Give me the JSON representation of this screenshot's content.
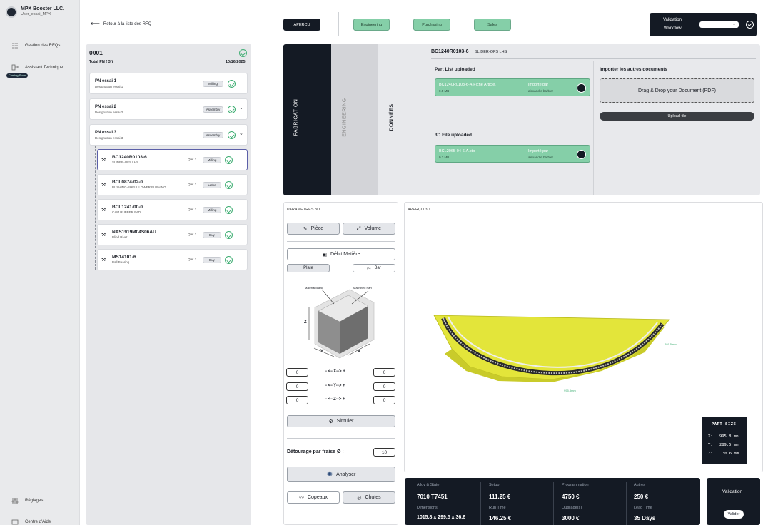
{
  "company": {
    "name": "MPX Booster LLC",
    "user": "User_essai_MPX"
  },
  "sidebar": {
    "items": [
      {
        "label": "Gestion des RFQs"
      },
      {
        "label": "Assistant Technique"
      },
      {
        "label": "Réglages"
      },
      {
        "label": "Centre d'Aide"
      }
    ],
    "beta_tag": "Coming Soon"
  },
  "topbar": {
    "back_label": "Retour à la liste des RFQ",
    "tabs": [
      {
        "label": "APERÇU",
        "style": "dark"
      },
      {
        "label": "Engineering",
        "style": "green"
      },
      {
        "label": "Purchasing",
        "style": "green"
      },
      {
        "label": "Sales",
        "style": "green"
      }
    ],
    "validation": {
      "line1": "Validation",
      "line2": "Workflow"
    }
  },
  "rfq": {
    "id": "0001",
    "total_pn": "Total PN ( 3 )",
    "date": "10/16/2025",
    "pns": [
      {
        "title": "PN essai 1",
        "designation": "Designation essai 1",
        "badge": "Milling",
        "has_chevron": false
      },
      {
        "title": "PN essai 2",
        "designation": "Designation essai 2",
        "badge": "Assembly",
        "has_chevron": true
      },
      {
        "title": "PN essai 3",
        "designation": "Designation essai 3",
        "badge": "Assembly",
        "has_chevron": true
      }
    ],
    "parts": [
      {
        "code": "BC1240R0103-6",
        "desc": "SLIDER-OFS LHS",
        "qty": "Qté: 1",
        "badge": "Milling",
        "selected": true
      },
      {
        "code": "BCL0874-02-0",
        "desc": "BUSHING-SHELL LOWER BUSHING",
        "qty": "Qté: 2",
        "badge": "Lathe",
        "selected": false
      },
      {
        "code": "BCL1241-00-0",
        "desc": "CAM RUBBER PAD",
        "qty": "Qté: 1",
        "badge": "Milling",
        "selected": false
      },
      {
        "code": "NAS1919M04S06AU",
        "desc": "Blind Rivet",
        "qty": "Qté: 2",
        "badge": "Buy",
        "selected": false
      },
      {
        "code": "MS14101-6",
        "desc": "Ball Bearing",
        "qty": "Qté: 1",
        "badge": "Buy",
        "selected": false
      }
    ]
  },
  "donnees": {
    "tab_fabrication": "FABRICATION",
    "tab_engineering": "ENGINEERING",
    "tab_donnees": "DONNÉES",
    "part_code": "BC1240R0103-6",
    "part_desc": "SLIDER-OFS LHS",
    "part_list_title": "Part List uploaded",
    "part_list_file": "BC1240R0103-6-A-Fiche Article.",
    "part_list_size": "0.5 MB",
    "imported_by": "Importé par",
    "importer": "alexandre barbier",
    "file3d_title": "3D File uploaded",
    "file3d_name": "BCL2065-04-6-A.stp",
    "file3d_size": "0.3 MB",
    "other_docs_title": "Importer les autres documents",
    "dropzone_label": "Drag & Drop your Document (PDF)",
    "upload_label": "Upload file"
  },
  "params": {
    "title": "PARAMETRES 3D",
    "btn_piece": "Pièce",
    "btn_volume": "Volume",
    "btn_debit": "Débit Matière",
    "btn_plate": "Plate",
    "btn_bar": "Bar",
    "diagram_material": "Material Blank",
    "diagram_machined": "Machined Part",
    "axis_z": "Z",
    "axis_y": "Y",
    "axis_x": "X",
    "rows": [
      {
        "left": "0",
        "label": "- <--X--> +",
        "right": "0"
      },
      {
        "left": "0",
        "label": "- <--Y--> +",
        "right": "0"
      },
      {
        "left": "0",
        "label": "- <--Z--> +",
        "right": "0"
      }
    ],
    "btn_simuler": "Simuler",
    "detourage_label": "Détourage par fraise Ø :",
    "detourage_value": "10",
    "btn_analyser": "Analyser",
    "btn_copeaux": "Copeaux",
    "btn_chutes": "Chutes"
  },
  "apercu": {
    "title": "APERÇU 3D",
    "dim_label_right": "289.5mm",
    "dim_label_bottom": "995.8mm",
    "part_size_title": "PART SIZE",
    "part_size": [
      {
        "axis": "X:",
        "value": "995.8",
        "unit": "mm"
      },
      {
        "axis": "Y:",
        "value": "289.5",
        "unit": "mm"
      },
      {
        "axis": "Z:",
        "value": "30.6",
        "unit": "mm"
      }
    ]
  },
  "cost": [
    {
      "label1": "Alloy & State",
      "value1": "7010 T7451",
      "label2": "Dimensions",
      "value2": "1015.8 x 299.5 x 36.6"
    },
    {
      "label1": "Setup",
      "value1": "111.25 €",
      "label2": "Run Time",
      "value2": "146.25 €"
    },
    {
      "label1": "Programmation",
      "value1": "4750 €",
      "label2": "Outillage(s)",
      "value2": "3000 €"
    },
    {
      "label1": "Autres",
      "value1": "250 €",
      "label2": "Lead Time",
      "value2": "35 Days"
    }
  ],
  "validation_bottom": {
    "title": "Validation",
    "button": "Valider"
  },
  "colors": {
    "dark": "#141a24",
    "green": "#85cfa8",
    "accent_check": "#3fae73",
    "part_yellow": "#e5e63a"
  }
}
